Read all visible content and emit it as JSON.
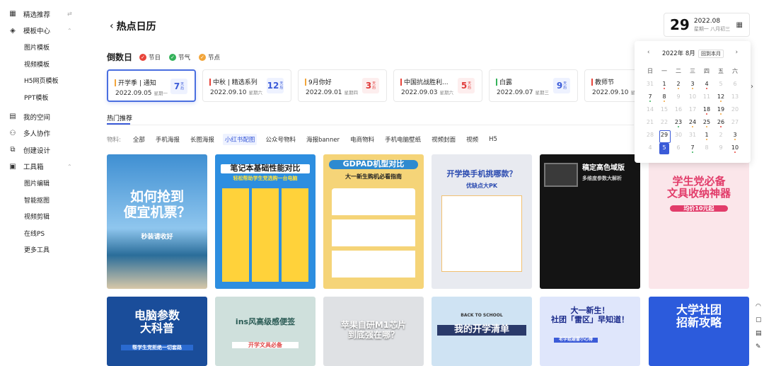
{
  "sidebar": {
    "items": [
      {
        "label": "精选推荐",
        "icon": "featured-icon"
      },
      {
        "label": "模板中心",
        "icon": "layers-icon"
      },
      {
        "label": "图片模板"
      },
      {
        "label": "视频模板"
      },
      {
        "label": "H5网页模板"
      },
      {
        "label": "PPT模板"
      },
      {
        "label": "我的空间",
        "icon": "folder-icon"
      },
      {
        "label": "多人协作",
        "icon": "users-icon"
      },
      {
        "label": "创建设计",
        "icon": "create-icon"
      },
      {
        "label": "工具箱",
        "icon": "toolbox-icon"
      },
      {
        "label": "图片编辑"
      },
      {
        "label": "智能抠图"
      },
      {
        "label": "视频剪辑"
      },
      {
        "label": "在线PS"
      },
      {
        "label": "更多工具"
      }
    ]
  },
  "header": {
    "title": "热点日历",
    "back_glyph": "‹"
  },
  "datebox": {
    "day": "29",
    "ym": "2022.08",
    "lunar": "星期一 八月初三"
  },
  "countdown": {
    "title": "倒数日",
    "legend": [
      {
        "label": "节日",
        "color": "#e8443a"
      },
      {
        "label": "节气",
        "color": "#34b25a"
      },
      {
        "label": "节点",
        "color": "#f2a53a"
      }
    ]
  },
  "events": [
    {
      "name": "开学季 | 通知",
      "date": "2022.09.05",
      "week": "星期一",
      "days": "7",
      "unit": "天后",
      "bar": "#f2a53a",
      "countColor": "blue",
      "active": true
    },
    {
      "name": "中秋 | 精选系列",
      "date": "2022.09.10",
      "week": "星期六",
      "days": "12",
      "unit": "天后",
      "bar": "#e8443a",
      "countColor": "blue"
    },
    {
      "name": "9月你好",
      "date": "2022.09.01",
      "week": "星期四",
      "days": "3",
      "unit": "天后",
      "bar": "#f2a53a",
      "countColor": "red"
    },
    {
      "name": "中国抗战胜利...",
      "date": "2022.09.03",
      "week": "星期六",
      "days": "5",
      "unit": "天后",
      "bar": "#e8443a",
      "countColor": "red"
    },
    {
      "name": "白露",
      "date": "2022.09.07",
      "week": "星期三",
      "days": "9",
      "unit": "天后",
      "bar": "#34b25a",
      "countColor": "blue"
    },
    {
      "name": "教师节",
      "date": "2022.09.10",
      "week": "星期六",
      "days": "",
      "unit": "",
      "bar": "#e8443a",
      "countColor": "blue"
    }
  ],
  "hot_tab": "热门推荐",
  "filters": {
    "label": "物料:",
    "items": [
      "全部",
      "手机海报",
      "长图海报",
      "小红书配图",
      "公众号物料",
      "海报banner",
      "电商物料",
      "手机电脑壁纸",
      "视频封面",
      "视频",
      "H5"
    ],
    "selected": 3
  },
  "thumbs": [
    {
      "title": "如何抢到\n便宜机票？",
      "sub": "秒装请收好"
    },
    {
      "title": "笔记本基础性能对比",
      "sub": "轻松帮助学生党选购一台电脑"
    },
    {
      "title": "GDPAD机型对比",
      "sub": "大一新生购机必看指南"
    },
    {
      "title": "开学换手机挑哪款？",
      "sub": "优缺点大PK"
    },
    {
      "title": "稿定高色域版",
      "sub": "多维度参数大解析"
    },
    {
      "title": "学生党必备\n文具收纳神器",
      "sub": "均价10元起"
    },
    {
      "title": "电脑参数\n大科普",
      "sub": "帮学生党拒绝一切套路"
    },
    {
      "title": "ins风高级感便签",
      "sub": "开学文具必备"
    },
    {
      "title": "苹果自研M1芯片\n到底强在哪？",
      "sub": ""
    },
    {
      "title": "我的开学清单",
      "sub": "BACK TO SCHOOL"
    },
    {
      "title": "大一新生！\n社团「雷区」早知道！",
      "sub": "老学姐避雷小心得"
    },
    {
      "title": "大学社团\n招新攻略",
      "sub": ""
    }
  ],
  "calendar": {
    "prev": "‹",
    "next": "›",
    "month": "2022年 8月",
    "today_btn": "回到本月",
    "weekdays": [
      "日",
      "一",
      "二",
      "三",
      "四",
      "五",
      "六"
    ],
    "days": [
      {
        "d": "31",
        "out": true
      },
      {
        "d": "1",
        "mk": "#e8443a"
      },
      {
        "d": "2",
        "mk": "#f2a53a"
      },
      {
        "d": "3",
        "mk": "#f2a53a"
      },
      {
        "d": "4",
        "mk": "#e8443a"
      },
      {
        "d": "5",
        "out": true
      },
      {
        "d": "6",
        "out": true
      },
      {
        "d": "7",
        "mk": "#34b25a"
      },
      {
        "d": "8",
        "mk": "#f2a53a"
      },
      {
        "d": "9",
        "out": true
      },
      {
        "d": "10",
        "out": true
      },
      {
        "d": "11",
        "out": true
      },
      {
        "d": "12",
        "mk": "#f2a53a"
      },
      {
        "d": "13",
        "out": true
      },
      {
        "d": "14",
        "out": true
      },
      {
        "d": "15",
        "out": true
      },
      {
        "d": "16",
        "out": true
      },
      {
        "d": "17",
        "out": true
      },
      {
        "d": "18",
        "mk": "#e8443a"
      },
      {
        "d": "19",
        "mk": "#f2a53a"
      },
      {
        "d": "20",
        "out": true
      },
      {
        "d": "21",
        "out": true
      },
      {
        "d": "22",
        "out": true
      },
      {
        "d": "23",
        "mk": "#34b25a"
      },
      {
        "d": "24",
        "mk": "#f2a53a"
      },
      {
        "d": "25",
        "mk": "#f2a53a"
      },
      {
        "d": "26",
        "mk": "#e8443a"
      },
      {
        "d": "27",
        "out": true
      },
      {
        "d": "28",
        "out": true
      },
      {
        "d": "29",
        "ring": true
      },
      {
        "d": "30",
        "out": true
      },
      {
        "d": "31",
        "out": true
      },
      {
        "d": "1",
        "mk": "#f2a53a"
      },
      {
        "d": "2",
        "out": true
      },
      {
        "d": "3",
        "mk": "#f2a53a"
      },
      {
        "d": "4",
        "out": true
      },
      {
        "d": "5",
        "cur": true
      },
      {
        "d": "6",
        "out": true
      },
      {
        "d": "7",
        "mk": "#34b25a"
      },
      {
        "d": "8",
        "out": true
      },
      {
        "d": "9",
        "out": true
      },
      {
        "d": "10",
        "mk": "#e8443a"
      }
    ]
  },
  "colors": {
    "accent": "#3b5bd8"
  }
}
